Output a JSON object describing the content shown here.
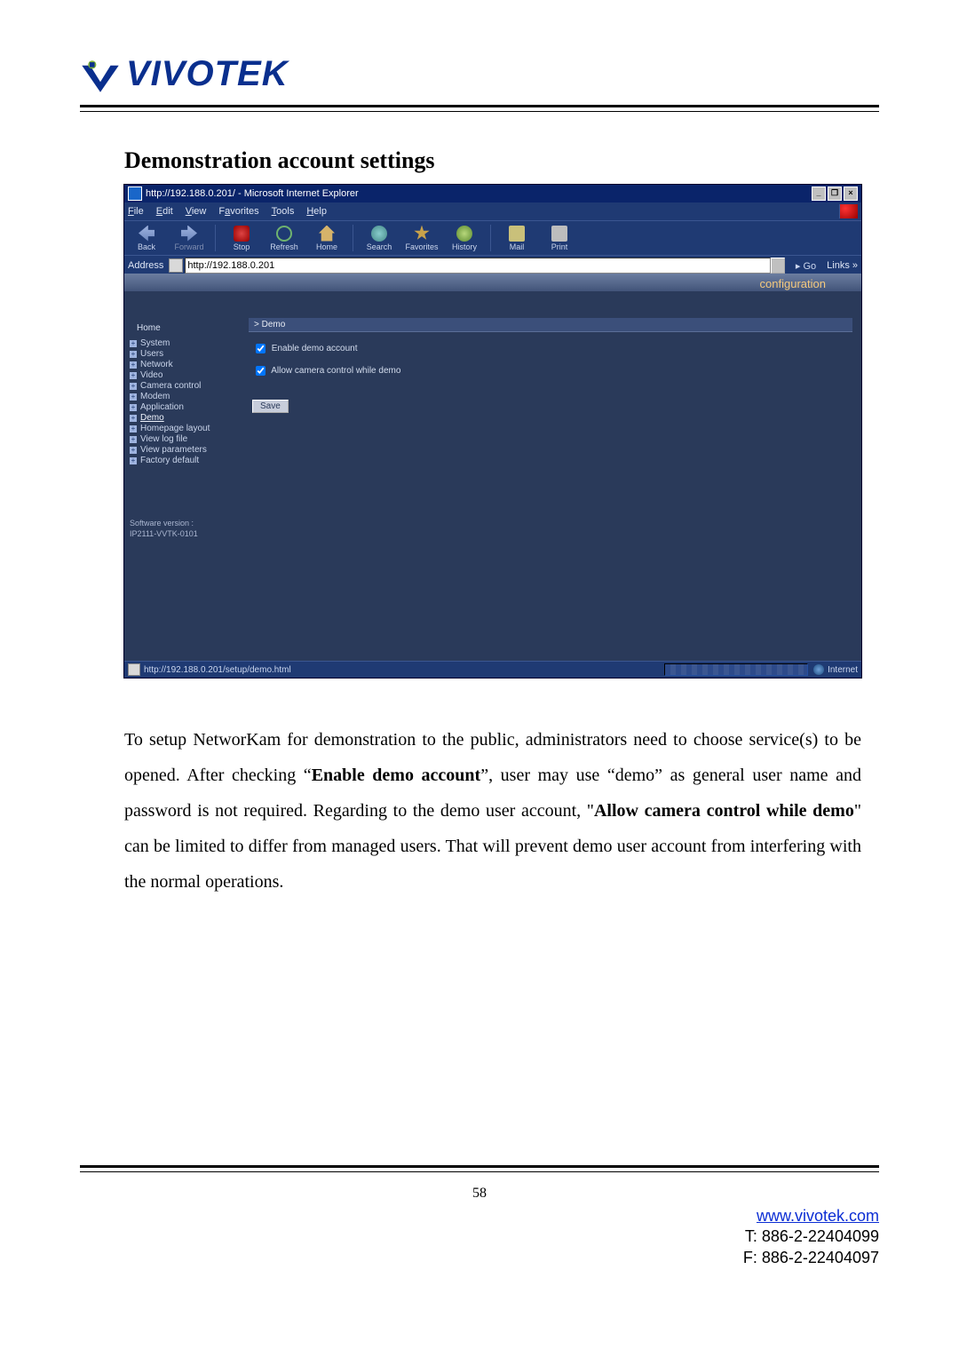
{
  "logo": {
    "text": "VIVOTEK"
  },
  "section_title": "Demonstration account settings",
  "ie": {
    "title": "http://192.188.0.201/ - Microsoft Internet Explorer",
    "menus": {
      "file": "File",
      "edit": "Edit",
      "view": "View",
      "favorites": "Favorites",
      "tools": "Tools",
      "help": "Help"
    },
    "toolbar": {
      "back": "Back",
      "forward": "Forward",
      "stop": "Stop",
      "refresh": "Refresh",
      "home": "Home",
      "search": "Search",
      "favorites": "Favorites",
      "history": "History",
      "mail": "Mail",
      "print": "Print"
    },
    "address_label": "Address",
    "address_value": "http://192.188.0.201",
    "go": "Go",
    "links": "Links »",
    "banner": "configuration",
    "sidebar": {
      "home": "Home",
      "items": [
        {
          "label": "System"
        },
        {
          "label": "Users"
        },
        {
          "label": "Network"
        },
        {
          "label": "Video"
        },
        {
          "label": "Camera control"
        },
        {
          "label": "Modem"
        },
        {
          "label": "Application"
        },
        {
          "label": "Demo",
          "current": true
        },
        {
          "label": "Homepage layout"
        },
        {
          "label": "View log file"
        },
        {
          "label": "View parameters"
        },
        {
          "label": "Factory default"
        }
      ],
      "version_label": "Software version :",
      "version_value": "IP2111-VVTK-0101"
    },
    "panel": {
      "header": "> Demo",
      "opt1": "Enable demo account",
      "opt2": "Allow camera control while demo",
      "save": "Save"
    },
    "status": {
      "url": "http://192.188.0.201/setup/demo.html",
      "zone": "Internet"
    }
  },
  "paragraph": {
    "p1a": "To setup NetworKam for demonstration to the public, administrators need to choose service(s) to be opened. After checking “",
    "b1": "Enable demo account",
    "p1b": "”, user may use “demo” as general user name and password is not required. Regarding to the demo user account, \"",
    "b2": "Allow camera control while demo",
    "p1c": "\" can be limited to differ from managed users. That will prevent demo user account from interfering with the normal operations."
  },
  "page_number": "58",
  "footer": {
    "url_text": "www.vivotek.com",
    "tel": "T: 886-2-22404099",
    "fax": "F: 886-2-22404097"
  }
}
